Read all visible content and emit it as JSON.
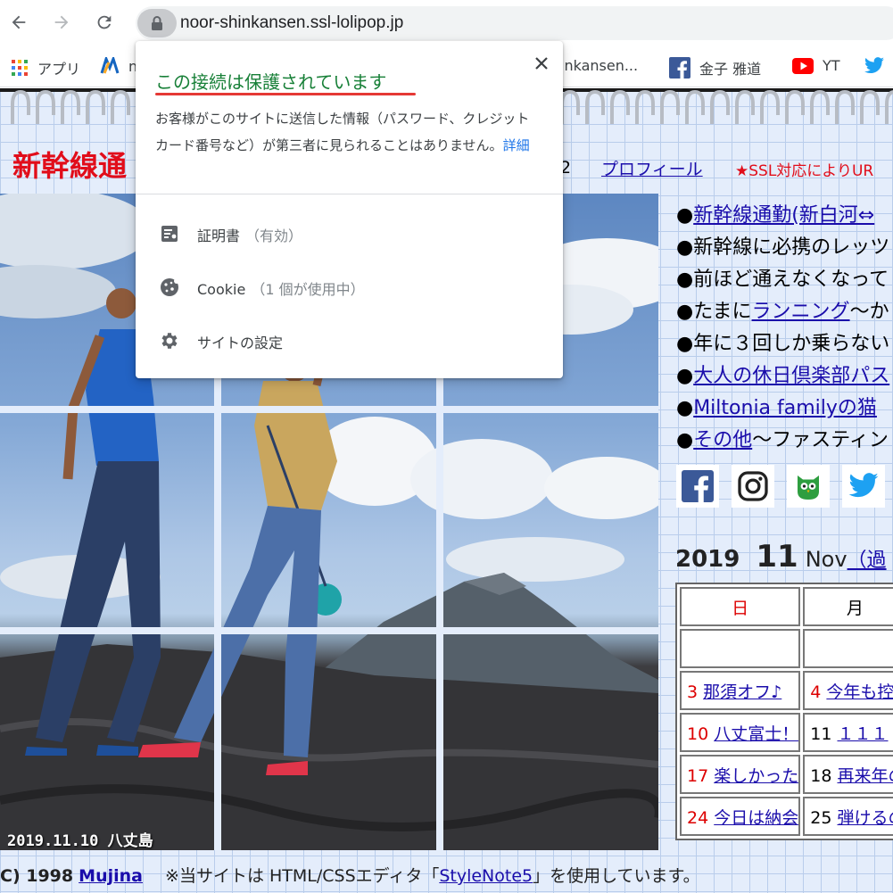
{
  "browser": {
    "url": "noor-shinkansen.ssl-lolipop.jp",
    "bookmarks": [
      {
        "label": "アプリ",
        "icon": "apps-grid-icon"
      },
      {
        "label": "n",
        "icon": "bookmark-n-icon"
      },
      {
        "label": "inkansen...",
        "icon": ""
      },
      {
        "label": "金子 雅道",
        "icon": "facebook-icon"
      },
      {
        "label": "YT",
        "icon": "youtube-icon"
      },
      {
        "label": "",
        "icon": "twitter-icon"
      }
    ]
  },
  "security_popup": {
    "title": "この接続は保護されています",
    "description": "お客様がこのサイトに送信した情報（パスワード、クレジット カード番号など）が第三者に見られることはありません。",
    "details_link": "詳細",
    "rows": [
      {
        "label": "証明書",
        "sub": "（有効）",
        "icon": "certificate-icon"
      },
      {
        "label": "Cookie",
        "sub": "（1 個が使用中）",
        "icon": "cookie-icon"
      },
      {
        "label": "サイトの設定",
        "sub": "",
        "icon": "gear-icon"
      }
    ]
  },
  "site": {
    "title": "新幹線通",
    "nav_number": "2",
    "nav_profile": "プロフィール",
    "ssl_note": "★SSL対応によりUR",
    "photo_caption": "2019.11.10 八丈島",
    "side_links": [
      {
        "prefix": "●",
        "link": "新幹線通勤(新白河⇔",
        "rest": ""
      },
      {
        "prefix": "●新幹線に必携のレッツ",
        "link": "",
        "rest": ""
      },
      {
        "prefix": "●前ほど通えなくなって",
        "link": "",
        "rest": ""
      },
      {
        "prefix": "●たまに",
        "link": "ランニング",
        "rest": "～か"
      },
      {
        "prefix": "●年に３回しか乗らない",
        "link": "",
        "rest": ""
      },
      {
        "prefix": "●",
        "link": "大人の休日倶楽部パス",
        "rest": ""
      },
      {
        "prefix": "●",
        "link": "Miltonia familyの猫",
        "rest": ""
      },
      {
        "prefix": "●",
        "link": "その他",
        "rest": "～ファスティン"
      }
    ],
    "social_icons": [
      "facebook-icon",
      "instagram-icon",
      "owl-icon",
      "twitter-icon"
    ],
    "calendar": {
      "year": "2019",
      "month": "11",
      "month_name": "Nov",
      "prev_label": "（過",
      "headers": [
        "日",
        "月"
      ],
      "rows": [
        [
          {
            "day": "",
            "link": ""
          },
          {
            "day": "",
            "link": ""
          }
        ],
        [
          {
            "day": "3",
            "link": "那須オフ♪"
          },
          {
            "day": "4",
            "link": "今年も控"
          }
        ],
        [
          {
            "day": "10",
            "link": "八丈富士！"
          },
          {
            "day": "11",
            "link": "１１１"
          }
        ],
        [
          {
            "day": "17",
            "link": "楽しかった"
          },
          {
            "day": "18",
            "link": "再来年の"
          }
        ],
        [
          {
            "day": "24",
            "link": "今日は納会"
          },
          {
            "day": "25",
            "link": "弾けるの"
          }
        ]
      ]
    },
    "footer": {
      "copyright": "C) 1998",
      "author": "Mujina",
      "note_prefix": "※当サイトは HTML/CSSエディタ「",
      "note_link": "StyleNote5",
      "note_suffix": "」を使用しています。"
    }
  },
  "colors": {
    "popup_title": "#188038",
    "site_title": "#e10d1a",
    "link": "#1a0dab",
    "page_bg": "#e4edfb"
  }
}
